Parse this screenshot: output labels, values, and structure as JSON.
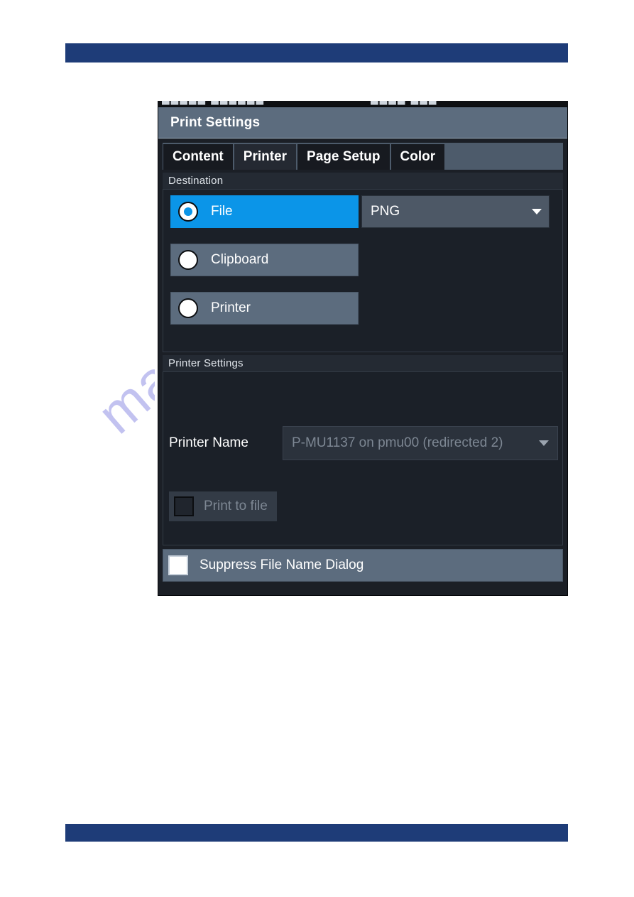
{
  "dialog": {
    "title": "Print Settings",
    "tabs": [
      {
        "label": "Content",
        "active": false
      },
      {
        "label": "Printer",
        "active": true
      },
      {
        "label": "Page Setup",
        "active": false
      },
      {
        "label": "Color",
        "active": false
      }
    ],
    "destination": {
      "group_label": "Destination",
      "options": [
        {
          "label": "File",
          "selected": true
        },
        {
          "label": "Clipboard",
          "selected": false
        },
        {
          "label": "Printer",
          "selected": false
        }
      ],
      "format": {
        "value": "PNG",
        "caret_icon": "chevron-down-icon"
      }
    },
    "printer_settings": {
      "group_label": "Printer Settings",
      "printer_name_label": "Printer Name",
      "printer_name_value": "P-MU1137 on pmu00 (redirected 2)",
      "print_to_file_label": "Print to file",
      "print_to_file_checked": false,
      "caret_icon": "chevron-down-icon"
    },
    "suppress": {
      "label": "Suppress File Name Dialog",
      "checked": false
    }
  },
  "page": {
    "watermark": "manualslive.com",
    "clipped_top_left": "█████ ██████",
    "clipped_top_right": "████ ███"
  },
  "colors": {
    "accent_blue": "#0b95e8",
    "titlebar": "#5c6c7e",
    "dialog_bg": "#1b1f26",
    "rule_blue": "#1e3c78"
  }
}
